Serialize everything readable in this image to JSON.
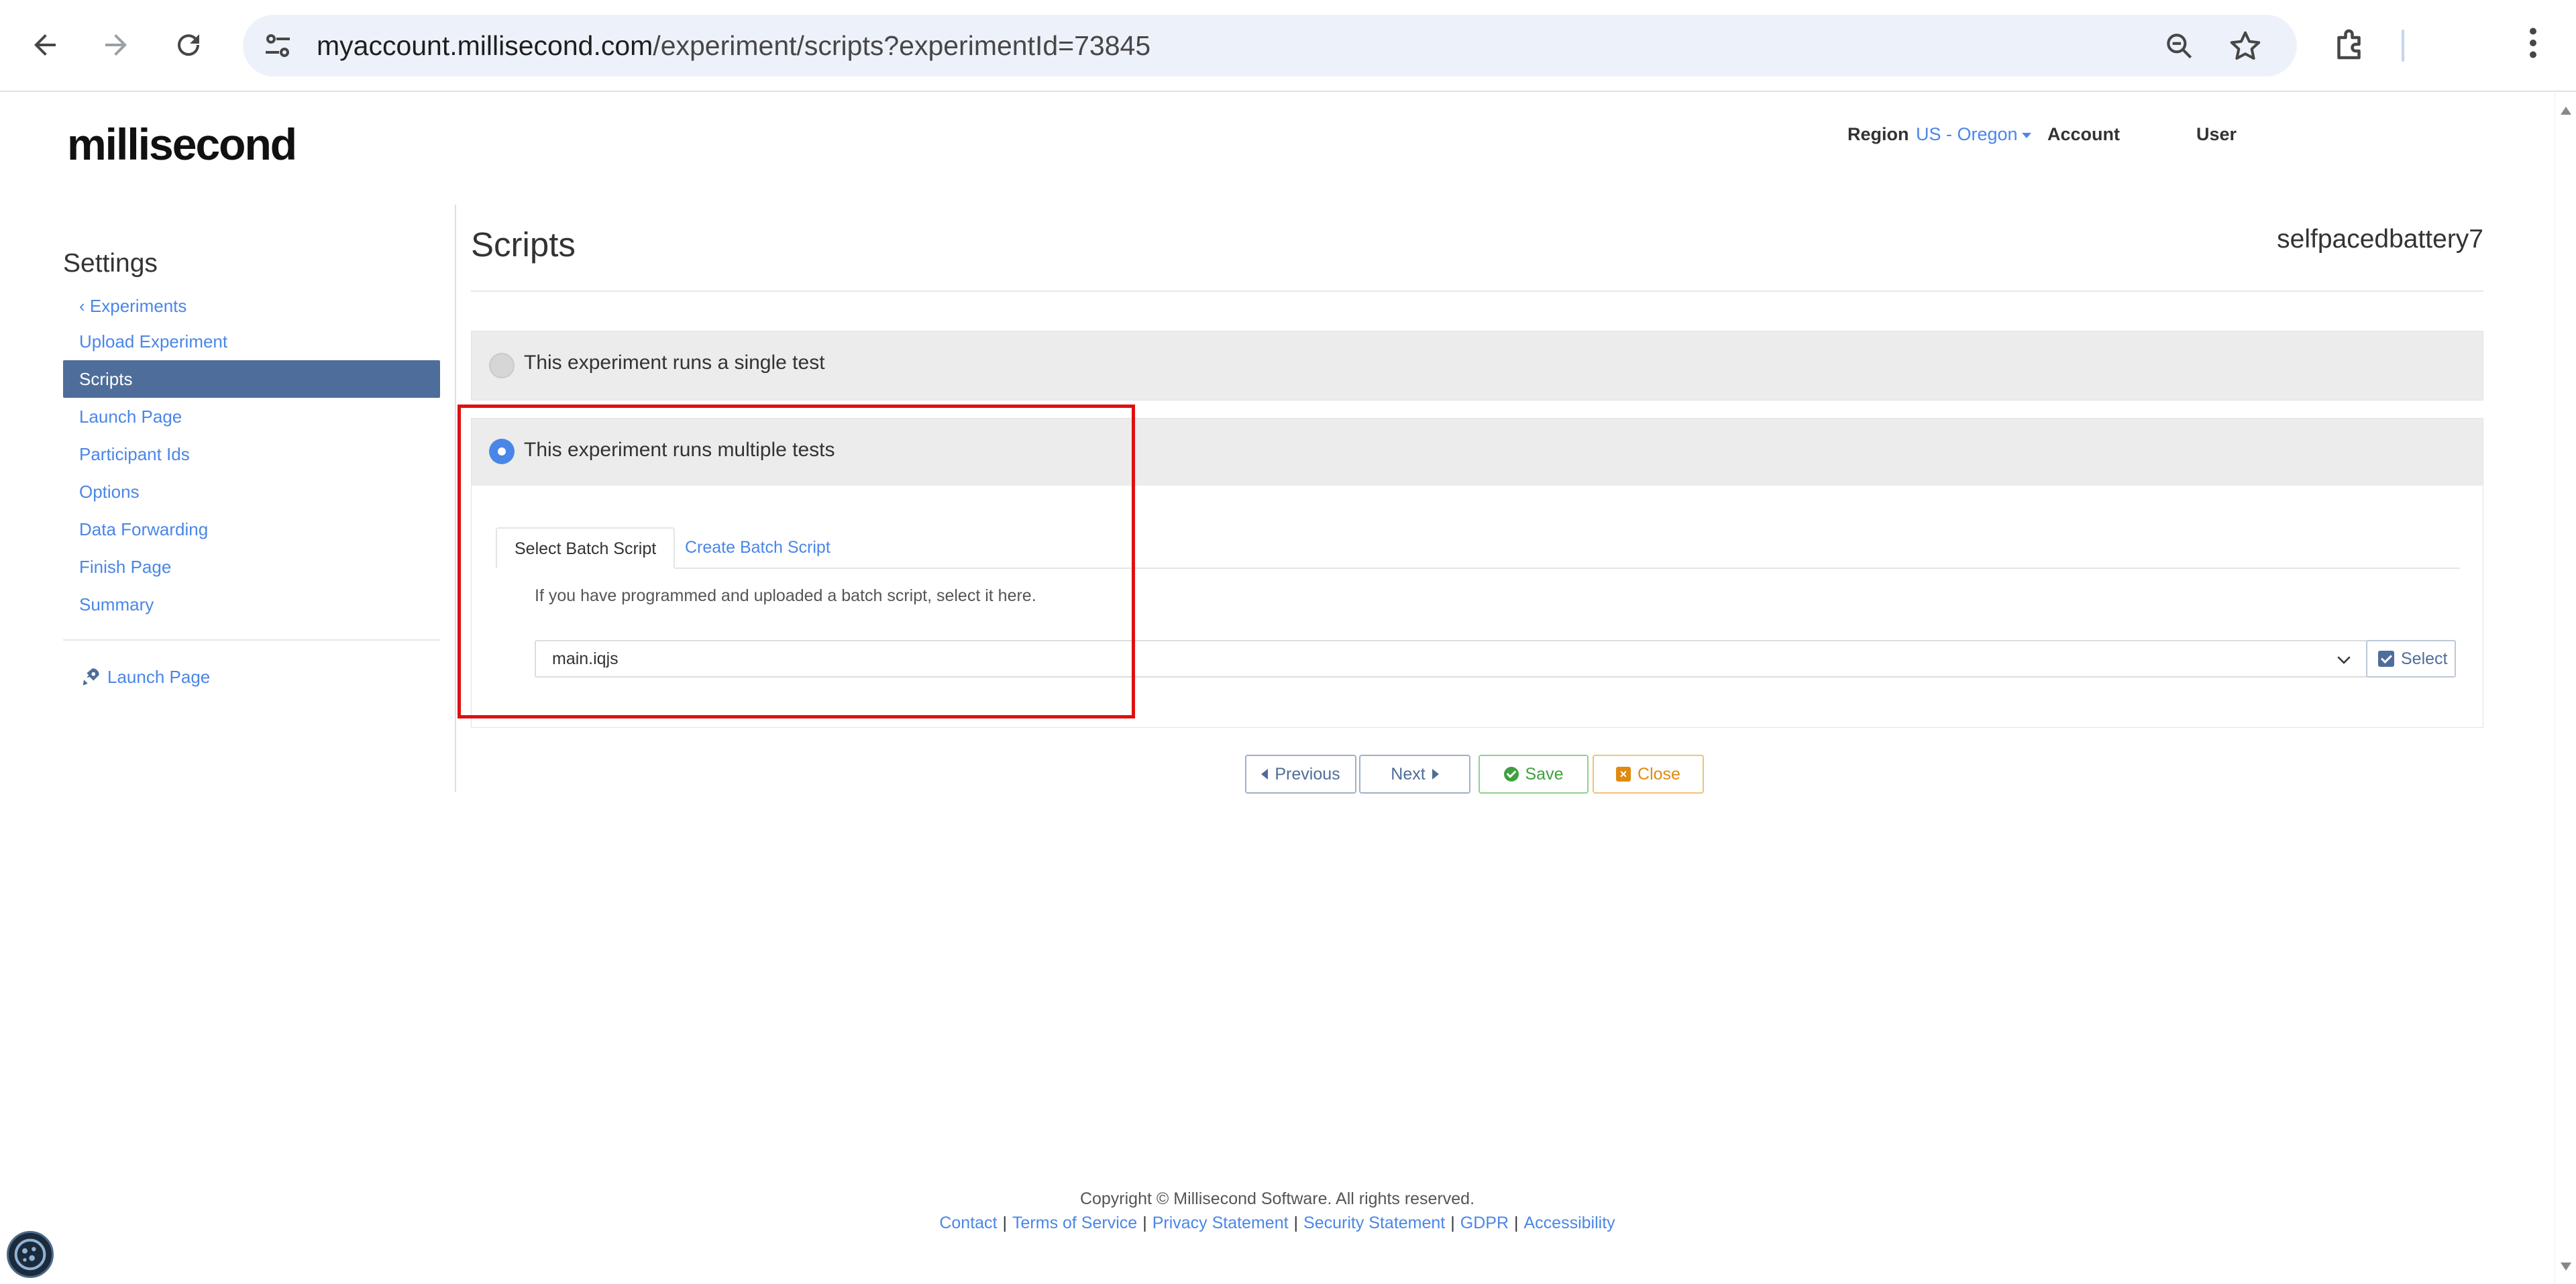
{
  "browser": {
    "url_host": "myaccount.millisecond.com",
    "url_path": "/experiment/scripts?experimentId=73845",
    "icons": [
      "back-icon",
      "forward-icon",
      "reload-icon",
      "site-settings-icon",
      "zoom-icon",
      "bookmark-star-icon",
      "extensions-icon",
      "menu-kebab-icon"
    ]
  },
  "header": {
    "logo": "millisecond",
    "region_label": "Region",
    "region_value": "US - Oregon",
    "account": "Account",
    "user": "User"
  },
  "sidebar": {
    "title": "Settings",
    "back_label": "Experiments",
    "items": [
      {
        "label": "Upload Experiment"
      },
      {
        "label": "Scripts"
      },
      {
        "label": "Launch Page"
      },
      {
        "label": "Participant Ids"
      },
      {
        "label": "Options"
      },
      {
        "label": "Data Forwarding"
      },
      {
        "label": "Finish Page"
      },
      {
        "label": "Summary"
      }
    ],
    "active_item": "Scripts",
    "launch_link": "Launch Page"
  },
  "main": {
    "title": "Scripts",
    "experiment_name": "selfpacedbattery7",
    "option_single": "This experiment runs a single test",
    "option_multiple": "This experiment runs multiple tests",
    "selected_option": "multiple",
    "tabs": [
      {
        "label": "Select Batch Script"
      },
      {
        "label": "Create Batch Script"
      }
    ],
    "active_tab": "Select Batch Script",
    "hint": "If you have programmed and uploaded a batch script, select it here.",
    "script_selected": "main.iqjs",
    "select_button": "Select"
  },
  "buttons": {
    "previous": "Previous",
    "next": "Next",
    "save": "Save",
    "close": "Close"
  },
  "footer": {
    "copyright": "Copyright © Millisecond Software. All rights reserved.",
    "links": [
      "Contact",
      "Terms of Service",
      "Privacy Statement",
      "Security Statement",
      "GDPR",
      "Accessibility"
    ]
  },
  "colors": {
    "accent": "#4a86e8",
    "sidebar_active": "#4f6d9a",
    "highlight": "#e01010",
    "save": "#3ea03e",
    "close": "#e08a12"
  }
}
